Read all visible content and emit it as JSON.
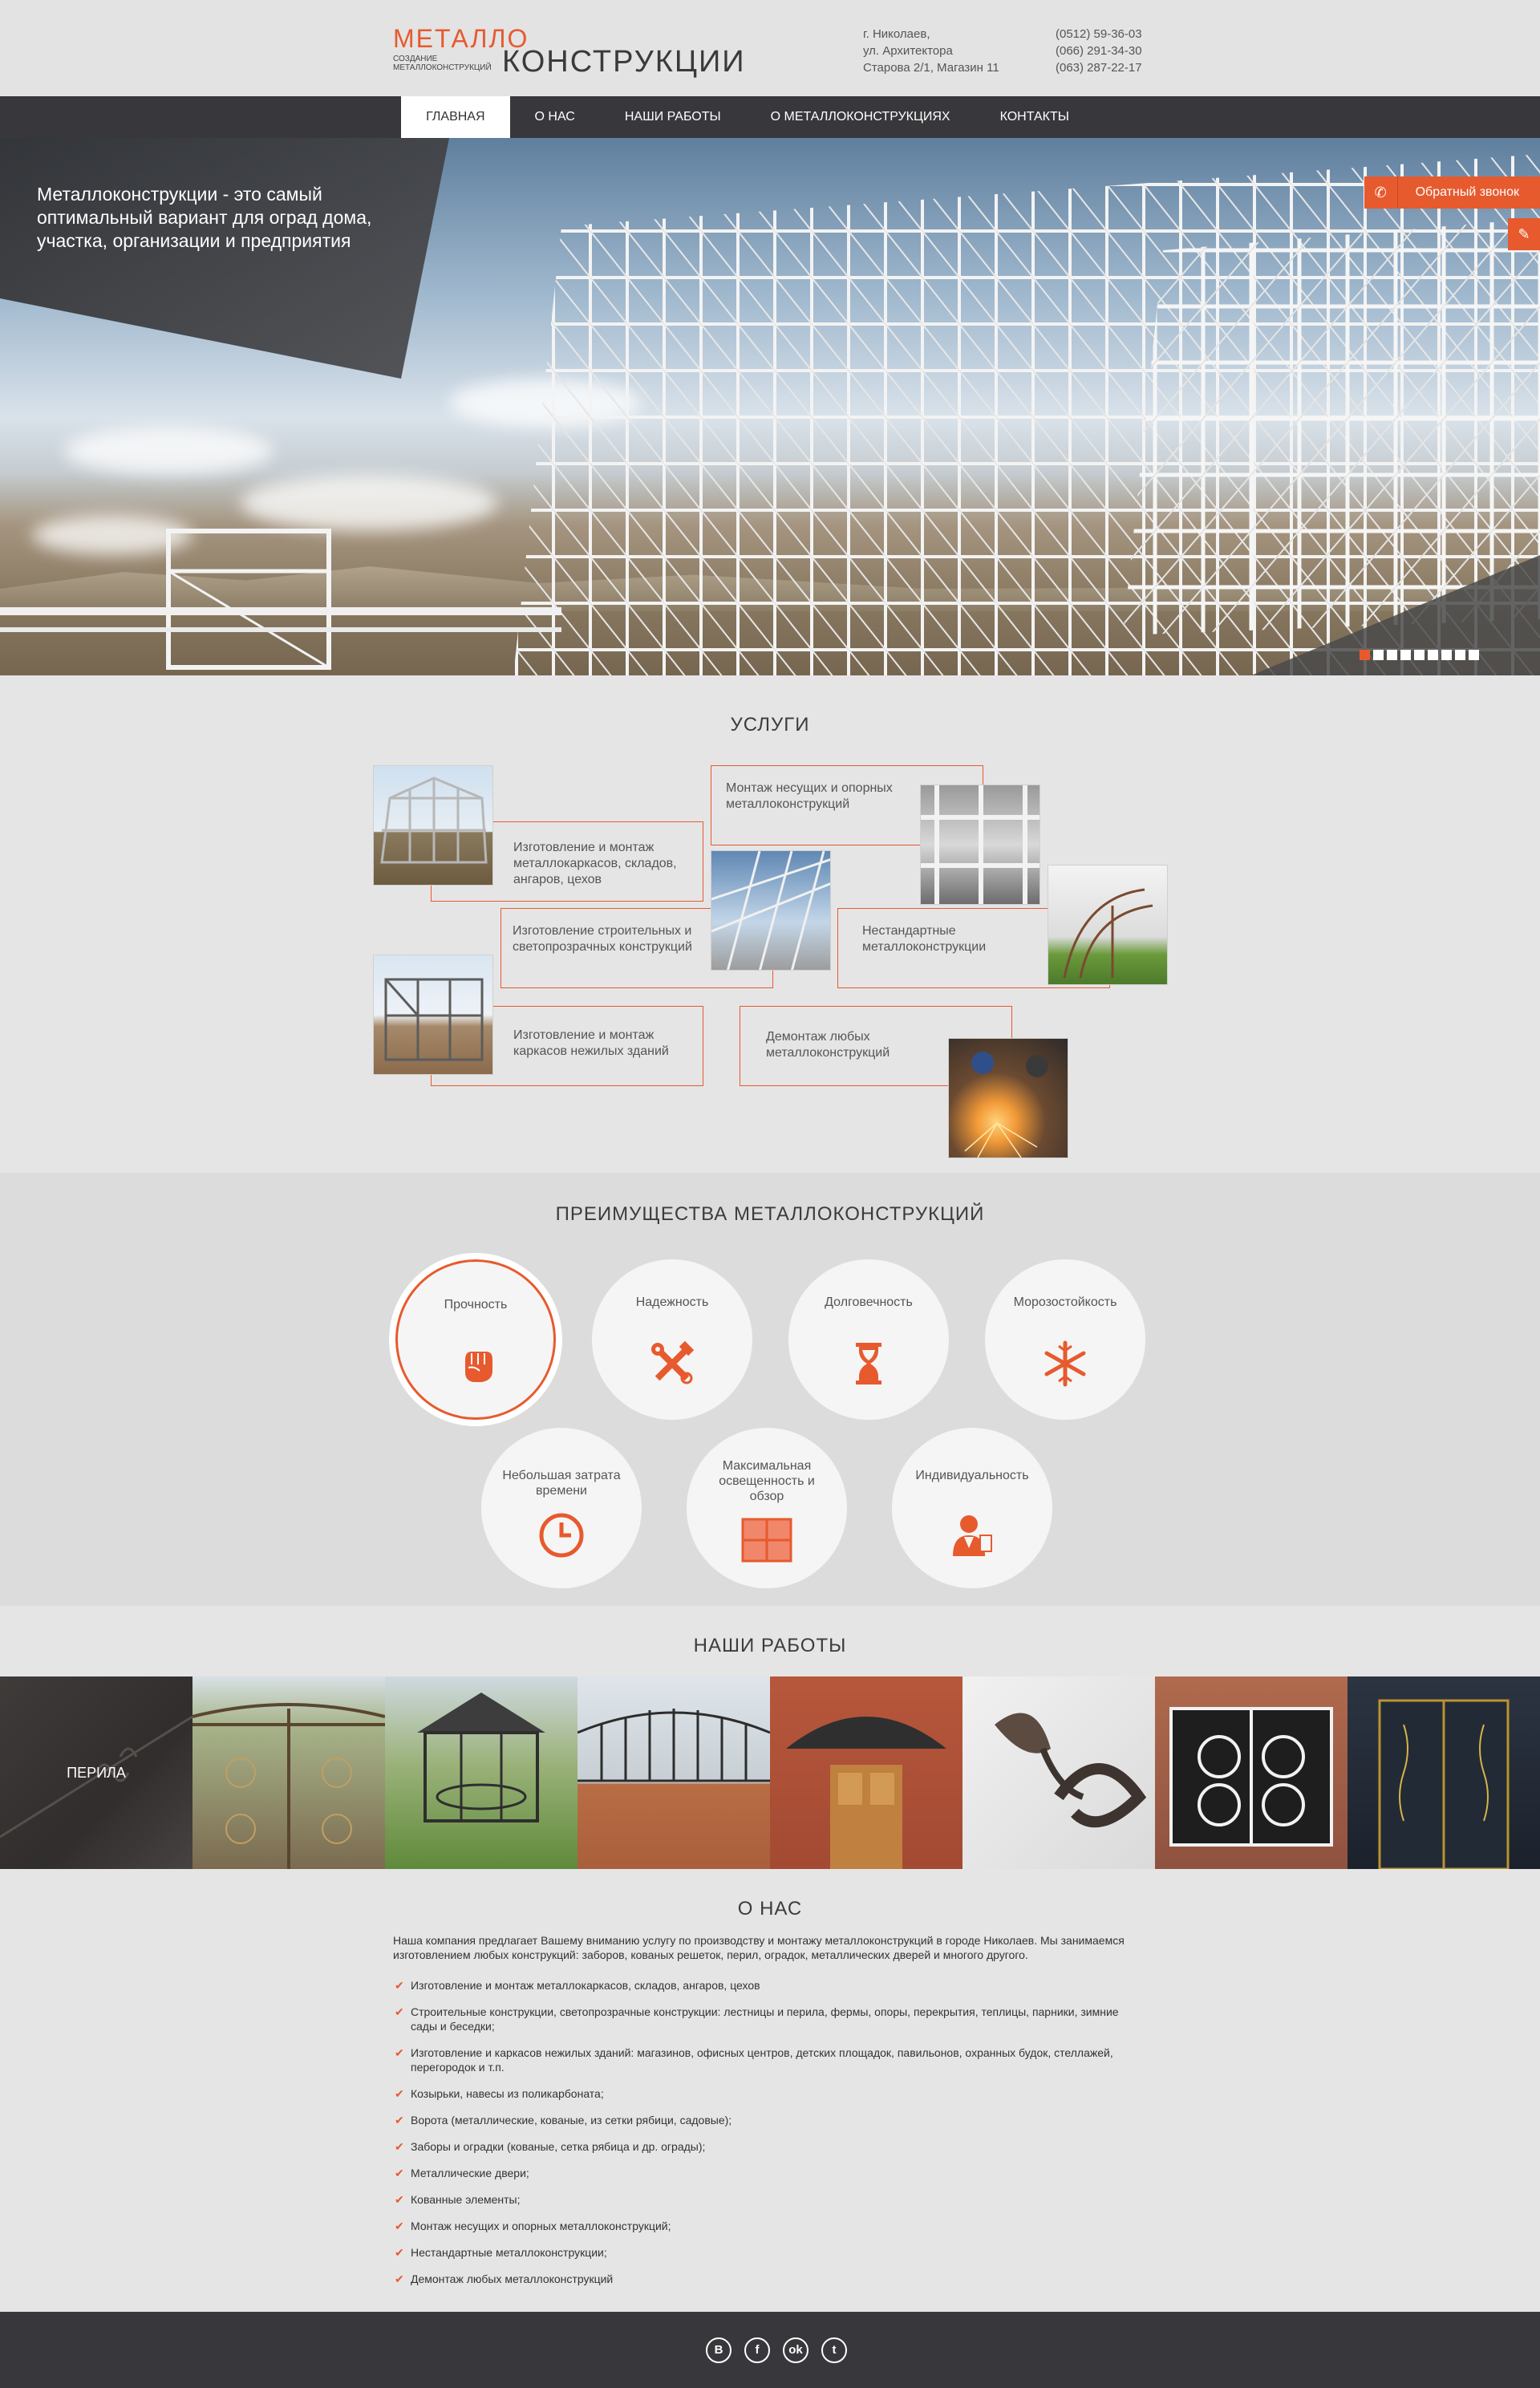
{
  "header": {
    "logo_top": "МЕТАЛЛО",
    "logo_sub": "СОЗДАНИЕ МЕТАЛЛОКОНСТРУКЦИЙ",
    "logo_bottom": "КОНСТРУКЦИИ",
    "address": [
      "г. Николаев,",
      "ул. Архитектора",
      "Старова 2/1, Магазин 11"
    ],
    "phones": [
      "(0512) 59-36-03",
      "(066) 291-34-30",
      "(063) 287-22-17"
    ]
  },
  "nav": {
    "items": [
      "ГЛАВНАЯ",
      "О НАС",
      "НАШИ РАБОТЫ",
      "О МЕТАЛЛОКОНСТРУКЦИЯХ",
      "КОНТАКТЫ"
    ],
    "active": "ГЛАВНАЯ"
  },
  "hero": {
    "text": "Металлоконструкции - это самый оптимальный вариант для оград дома, участка, организации и предприятия",
    "callback_label": "Обратный звонок",
    "slide_count": 9,
    "active_slide": 1
  },
  "services": {
    "title": "УСЛУГИ",
    "items": [
      "Изготовление и монтаж металлокаркасов, складов, ангаров, цехов",
      "Монтаж несущих и опорных металлоконструкций",
      "Изготовление строительных и светопрозрачных конструкций",
      "Нестандартные металлоконструкции",
      "Изготовление и монтаж каркасов нежилых зданий",
      "Демонтаж любых металлоконструкций"
    ]
  },
  "advantages": {
    "title": "ПРЕИМУЩЕСТВА МЕТАЛЛОКОНСТРУКЦИЙ",
    "items": [
      {
        "label": "Прочность",
        "icon": "fist-icon"
      },
      {
        "label": "Надежность",
        "icon": "tools-icon"
      },
      {
        "label": "Долговечность",
        "icon": "hourglass-icon"
      },
      {
        "label": "Морозостойкость",
        "icon": "snowflake-icon"
      },
      {
        "label": "Небольшая затрата времени",
        "icon": "clock-icon"
      },
      {
        "label": "Максимальная освещенность и обзор",
        "icon": "window-icon"
      },
      {
        "label": "Индивидуальность",
        "icon": "person-icon"
      }
    ],
    "accent": "#e75a2e"
  },
  "works": {
    "title": "НАШИ РАБОТЫ",
    "caption": "ПЕРИЛА"
  },
  "about": {
    "title": "О НАС",
    "intro": "Наша компания предлагает Вашему вниманию услугу по производству и монтажу металлоконструкций в городе Николаев. Мы занимаемся изготовлением любых конструкций: заборов, кованых решеток, перил, оградок, металлических дверей и многого другого.",
    "list": [
      "Изготовление и монтаж металлокаркасов, складов, ангаров, цехов",
      "Строительные конструкции, светопрозрачные конструкции: лестницы и перила, фермы, опоры, перекрытия, теплицы, парники, зимние сады и беседки;",
      "Изготовление и каркасов нежилых зданий: магазинов, офисных центров, детских площадок, павильонов, охранных будок, стеллажей, перегородок и т.п.",
      "Козырьки, навесы из поликарбоната;",
      "Ворота (металлические, кованые, из сетки рябици, садовые);",
      "Заборы и оградки (кованые, сетка рябица и др. ограды);",
      "Металлические двери;",
      "Кованные элементы;",
      "Монтаж несущих и опорных металлоконструкций;",
      "Нестандартные металлоконструкции;",
      "Демонтаж любых металлоконструкций"
    ]
  },
  "footer": {
    "social": [
      {
        "label": "В",
        "icon": "vk-icon"
      },
      {
        "label": "f",
        "icon": "facebook-icon"
      },
      {
        "label": "ok",
        "icon": "odnoklassniki-icon"
      },
      {
        "label": "t",
        "icon": "twitter-icon"
      }
    ]
  },
  "colors": {
    "accent": "#e75a2e",
    "dark": "#38383c",
    "background": "#e5e5e5"
  }
}
